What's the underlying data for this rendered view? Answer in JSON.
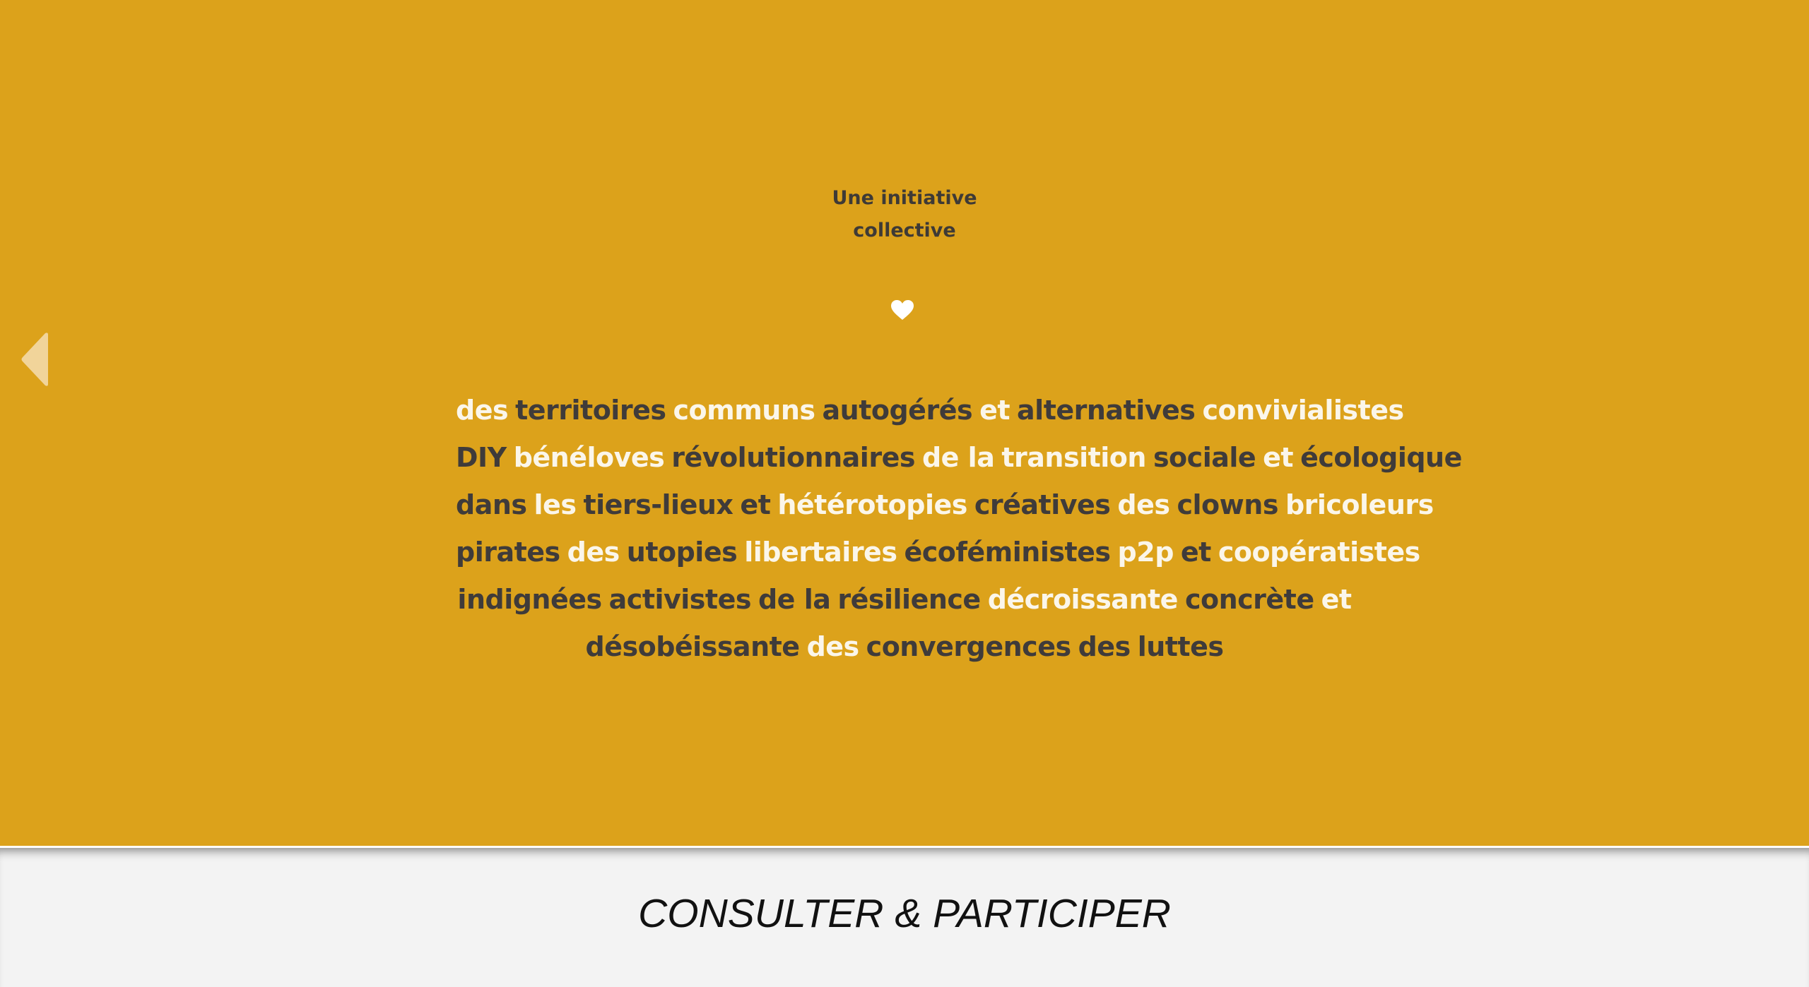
{
  "colors": {
    "background": "#dca21b",
    "light_text": "#fbf6ea",
    "dark_text": "#3f3b3a",
    "footer_bg": "#f3f3f3"
  },
  "icons": {
    "prev": "triangle-left-icon",
    "heart": "heart-icon"
  },
  "tagline": {
    "line1": "Une initiative",
    "line2": "collective"
  },
  "word_cloud": [
    [
      {
        "t": "des",
        "c": "light"
      },
      {
        "t": "territoires",
        "c": "dark"
      },
      {
        "t": "communs",
        "c": "light"
      },
      {
        "t": "autogérés",
        "c": "dark"
      },
      {
        "t": "et",
        "c": "light"
      },
      {
        "t": "alternatives",
        "c": "dark"
      },
      {
        "t": "convivialistes",
        "c": "light"
      }
    ],
    [
      {
        "t": "DIY",
        "c": "dark"
      },
      {
        "t": "bénéloves",
        "c": "light"
      },
      {
        "t": "révolutionnaires",
        "c": "dark"
      },
      {
        "t": "de la",
        "c": "light"
      },
      {
        "t": "transition",
        "c": "light"
      },
      {
        "t": "sociale",
        "c": "dark"
      },
      {
        "t": "et",
        "c": "light"
      },
      {
        "t": "écologique",
        "c": "dark"
      }
    ],
    [
      {
        "t": "dans",
        "c": "dark"
      },
      {
        "t": "les",
        "c": "light"
      },
      {
        "t": "tiers-lieux",
        "c": "dark"
      },
      {
        "t": "et",
        "c": "dark"
      },
      {
        "t": "hétérotopies",
        "c": "light"
      },
      {
        "t": "créatives",
        "c": "dark"
      },
      {
        "t": "des",
        "c": "light"
      },
      {
        "t": "clowns",
        "c": "dark"
      },
      {
        "t": "bricoleurs",
        "c": "light"
      }
    ],
    [
      {
        "t": "pirates",
        "c": "dark"
      },
      {
        "t": "des",
        "c": "light"
      },
      {
        "t": "utopies",
        "c": "dark"
      },
      {
        "t": "libertaires",
        "c": "light"
      },
      {
        "t": "écoféministes",
        "c": "dark"
      },
      {
        "t": "p2p",
        "c": "light"
      },
      {
        "t": "et",
        "c": "dark"
      },
      {
        "t": "coopératistes",
        "c": "light"
      }
    ],
    [
      {
        "t": "indignées",
        "c": "dark"
      },
      {
        "t": "activistes",
        "c": "dark"
      },
      {
        "t": "de la",
        "c": "dark"
      },
      {
        "t": "résilience",
        "c": "dark"
      },
      {
        "t": "décroissante",
        "c": "light"
      },
      {
        "t": "concrète",
        "c": "dark"
      },
      {
        "t": "et",
        "c": "light"
      }
    ],
    [
      {
        "t": "désobéissante",
        "c": "dark"
      },
      {
        "t": "des",
        "c": "light"
      },
      {
        "t": "convergences",
        "c": "dark"
      },
      {
        "t": "des",
        "c": "dark"
      },
      {
        "t": "luttes",
        "c": "dark"
      }
    ]
  ],
  "footer": {
    "cta_label": "CONSULTER & PARTICIPER"
  }
}
